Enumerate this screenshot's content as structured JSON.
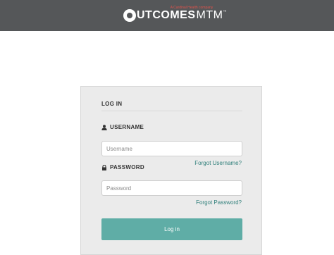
{
  "header": {
    "tagline": "A Cardinal Health company",
    "logo_main": "UTCOMES",
    "logo_sub": "MTM",
    "logo_tm": "™",
    "background": "#555759"
  },
  "login": {
    "title": "LOG IN",
    "username_label": "USERNAME",
    "username_placeholder": "Username",
    "username_value": "",
    "forgot_username": "Forgot Username?",
    "password_label": "PASSWORD",
    "password_placeholder": "Password",
    "password_value": "",
    "forgot_password": "Forgot Password?",
    "submit_label": "Log in",
    "accent_color": "#5fada6",
    "link_color": "#2f7f7a"
  },
  "icons": {
    "user": "user-icon",
    "lock": "lock-icon"
  }
}
